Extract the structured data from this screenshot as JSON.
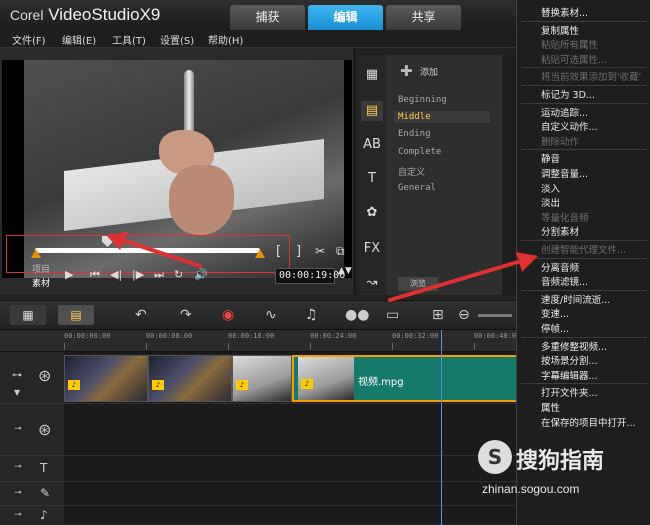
{
  "app": {
    "brand_prefix": "Corel",
    "brand_name": "VideoStudioX9"
  },
  "top_tabs": [
    {
      "label": "捕获"
    },
    {
      "label": "编辑",
      "active": true
    },
    {
      "label": "共享"
    }
  ],
  "menu": [
    {
      "label": "文件(F)"
    },
    {
      "label": "编辑(E)"
    },
    {
      "label": "工具(T)"
    },
    {
      "label": "设置(S)"
    },
    {
      "label": "帮助(H)"
    }
  ],
  "preview": {
    "label_project": "项目",
    "label_clip": "素材",
    "timecode": "00:00:19:06",
    "trim_brackets": [
      "[",
      "]"
    ]
  },
  "library": {
    "add_label": "添加",
    "items": [
      {
        "label": "Beginning"
      },
      {
        "label": "Middle",
        "active": true
      },
      {
        "label": "Ending"
      },
      {
        "label": "Complete"
      },
      {
        "label": "自定义"
      },
      {
        "label": "General"
      }
    ],
    "browse_label": "浏览"
  },
  "context_menu": {
    "items": [
      {
        "label": "替换素材...",
        "disabled": false
      },
      {
        "separator": true
      },
      {
        "label": "复制属性",
        "disabled": false
      },
      {
        "label": "粘贴所有属性",
        "disabled": true
      },
      {
        "label": "粘贴可选属性...",
        "disabled": true
      },
      {
        "separator": true
      },
      {
        "label": "将当前效果添加到'收藏'",
        "disabled": true
      },
      {
        "separator": true
      },
      {
        "label": "标记为 3D...",
        "disabled": false
      },
      {
        "separator": true
      },
      {
        "label": "运动追踪...",
        "disabled": false
      },
      {
        "label": "自定义动作...",
        "disabled": false
      },
      {
        "label": "删除动作",
        "disabled": true
      },
      {
        "separator": true
      },
      {
        "label": "静音",
        "disabled": false
      },
      {
        "label": "调整音量...",
        "disabled": false
      },
      {
        "label": "淡入",
        "disabled": false
      },
      {
        "label": "淡出",
        "disabled": false
      },
      {
        "label": "等量化音频",
        "disabled": true
      },
      {
        "label": "分割素材",
        "disabled": false
      },
      {
        "separator": true
      },
      {
        "label": "创建智能代理文件...",
        "disabled": true
      },
      {
        "separator": true
      },
      {
        "label": "分离音频",
        "disabled": false
      },
      {
        "label": "音频滤镜...",
        "disabled": false
      },
      {
        "separator": true
      },
      {
        "label": "速度/时间流逝...",
        "disabled": false
      },
      {
        "label": "变速...",
        "disabled": false
      },
      {
        "label": "停帧...",
        "disabled": false
      },
      {
        "separator": true
      },
      {
        "label": "多重修整视频...",
        "disabled": false
      },
      {
        "label": "按场景分割...",
        "disabled": false
      },
      {
        "label": "字幕编辑器...",
        "disabled": false
      },
      {
        "separator": true
      },
      {
        "label": "打开文件夹...",
        "disabled": false
      },
      {
        "label": "属性",
        "disabled": false
      },
      {
        "label": "在保存的项目中打开...",
        "disabled": false
      }
    ]
  },
  "ruler": {
    "labels": [
      "00:00:00:00",
      "00:00:08:00",
      "00:00:16:00",
      "00:00:24:00",
      "00:00:32:00",
      "00:00:40:00"
    ]
  },
  "timeline": {
    "main_clip_label": "视频.mpg"
  },
  "watermark": {
    "mark": "S",
    "text": "搜狗指南",
    "url": "zhinan.sogou.com"
  },
  "colors": {
    "accent": "#1a8fd3",
    "clip_teal": "#167a6a",
    "highlight": "#ffd24a",
    "annotation_red": "#e03030"
  }
}
